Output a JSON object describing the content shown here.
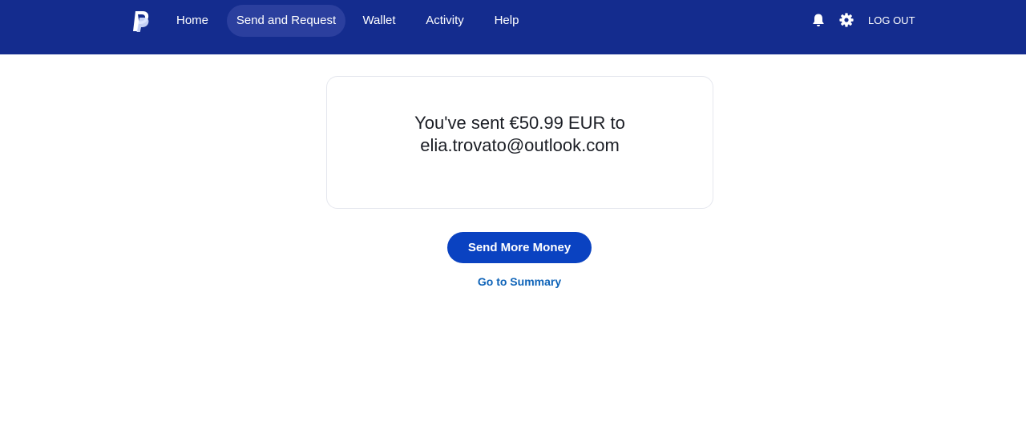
{
  "header": {
    "logo": "paypal-logo",
    "nav": [
      {
        "label": "Home",
        "active": false
      },
      {
        "label": "Send and Request",
        "active": true
      },
      {
        "label": "Wallet",
        "active": false
      },
      {
        "label": "Activity",
        "active": false
      },
      {
        "label": "Help",
        "active": false
      }
    ],
    "icons": [
      "bell-icon",
      "gear-icon"
    ],
    "logout_label": "LOG OUT"
  },
  "confirmation": {
    "line1": "You've sent €50.99 EUR to",
    "line2": "elia.trovato@outlook.com"
  },
  "actions": {
    "primary_label": "Send More Money",
    "link_label": "Go to Summary"
  },
  "colors": {
    "header_bg": "#142c8e",
    "active_nav_bg": "#2b3f9e",
    "primary_button": "#0a42c1",
    "link": "#0e63b8"
  }
}
